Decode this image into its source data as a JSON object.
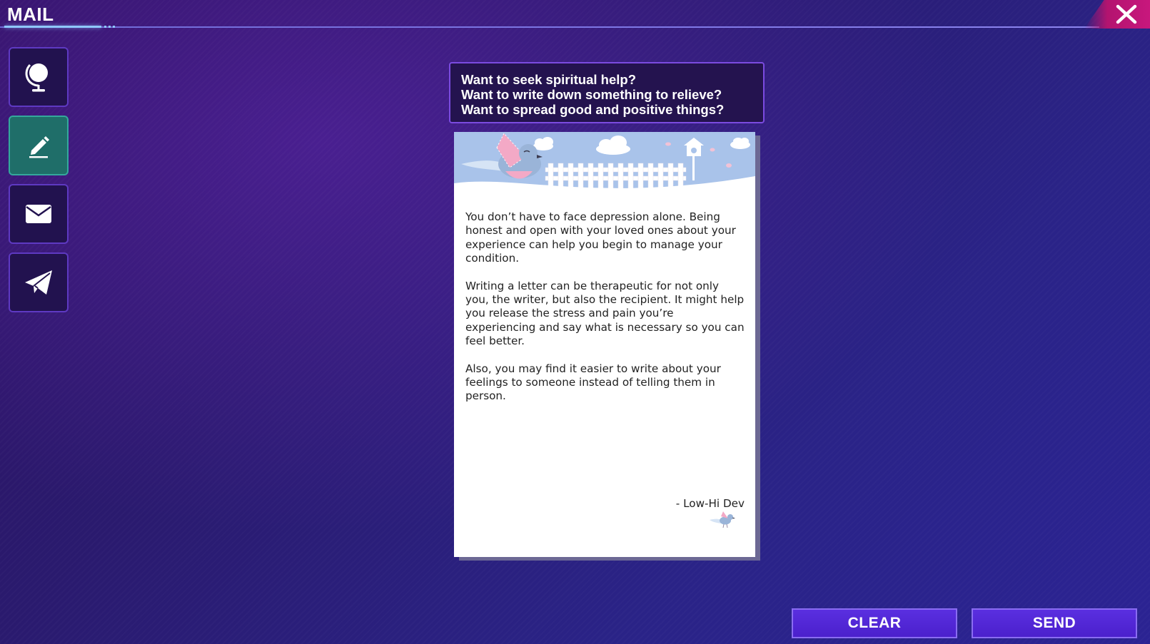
{
  "window": {
    "title": "MAIL",
    "close_icon": "close-x-icon"
  },
  "colors": {
    "close_button": "#c8177d",
    "active_menu": "#1f6e69",
    "action_button": "#5a2fe0",
    "title_accent": "#8fc8ff"
  },
  "sidebar": {
    "items": [
      {
        "id": "globe",
        "icon": "globe-icon",
        "active": false
      },
      {
        "id": "write",
        "icon": "pencil-icon",
        "active": true
      },
      {
        "id": "inbox",
        "icon": "envelope-icon",
        "active": false
      },
      {
        "id": "send",
        "icon": "paper-plane-icon",
        "active": false
      }
    ]
  },
  "prompt": {
    "lines": [
      "Want to seek spiritual help?",
      "Want to write down something to relieve?",
      "Want to spread good and positive things?"
    ]
  },
  "letter": {
    "paragraphs": [
      "You don’t have to face depression alone. Being honest and open with your loved ones about your experience can help you begin to manage your condition.",
      "Writing a letter can be therapeutic for not only you, the writer, but also the recipient. It might help you release the stress and pain you’re experiencing and say what is necessary so you can feel better.",
      "Also, you may find it easier to write about your feelings to someone instead of telling them in person."
    ],
    "signature": "- Low-Hi Dev",
    "banner_icon": "bird-fence-illustration",
    "signature_icon": "small-bird-icon"
  },
  "actions": {
    "clear_label": "CLEAR",
    "send_label": "SEND"
  }
}
